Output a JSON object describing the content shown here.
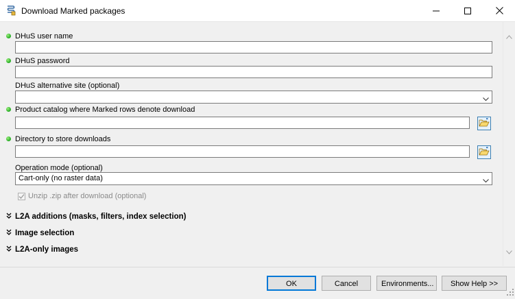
{
  "window": {
    "title": "Download Marked packages",
    "icons": {
      "app": "script-tool-icon",
      "minimize": "minimize-icon",
      "maximize": "maximize-icon",
      "close": "close-icon"
    }
  },
  "form": {
    "user_name": {
      "label": "DHuS user name",
      "value": "",
      "required": true
    },
    "password": {
      "label": "DHuS password",
      "value": "",
      "required": true
    },
    "alt_site": {
      "label": "DHuS alternative site (optional)",
      "value": ""
    },
    "catalog": {
      "label": "Product catalog where Marked rows denote download",
      "value": "",
      "required": true
    },
    "directory": {
      "label": "Directory to store downloads",
      "value": "",
      "required": true
    },
    "operation_mode": {
      "label": "Operation mode (optional)",
      "value": "Cart-only (no raster data)"
    },
    "unzip": {
      "label": "Unzip .zip after download (optional)",
      "checked": true,
      "enabled": false
    }
  },
  "sections": [
    {
      "label": "L2A additions (masks, filters, index selection)"
    },
    {
      "label": "Image selection"
    },
    {
      "label": "L2A-only images"
    }
  ],
  "footer": {
    "ok": "OK",
    "cancel": "Cancel",
    "environments": "Environments...",
    "show_help": "Show Help >>"
  },
  "colors": {
    "required_dot": "#1fa81f",
    "focus_border": "#0078d7",
    "window_bg": "#f0f0f0"
  }
}
